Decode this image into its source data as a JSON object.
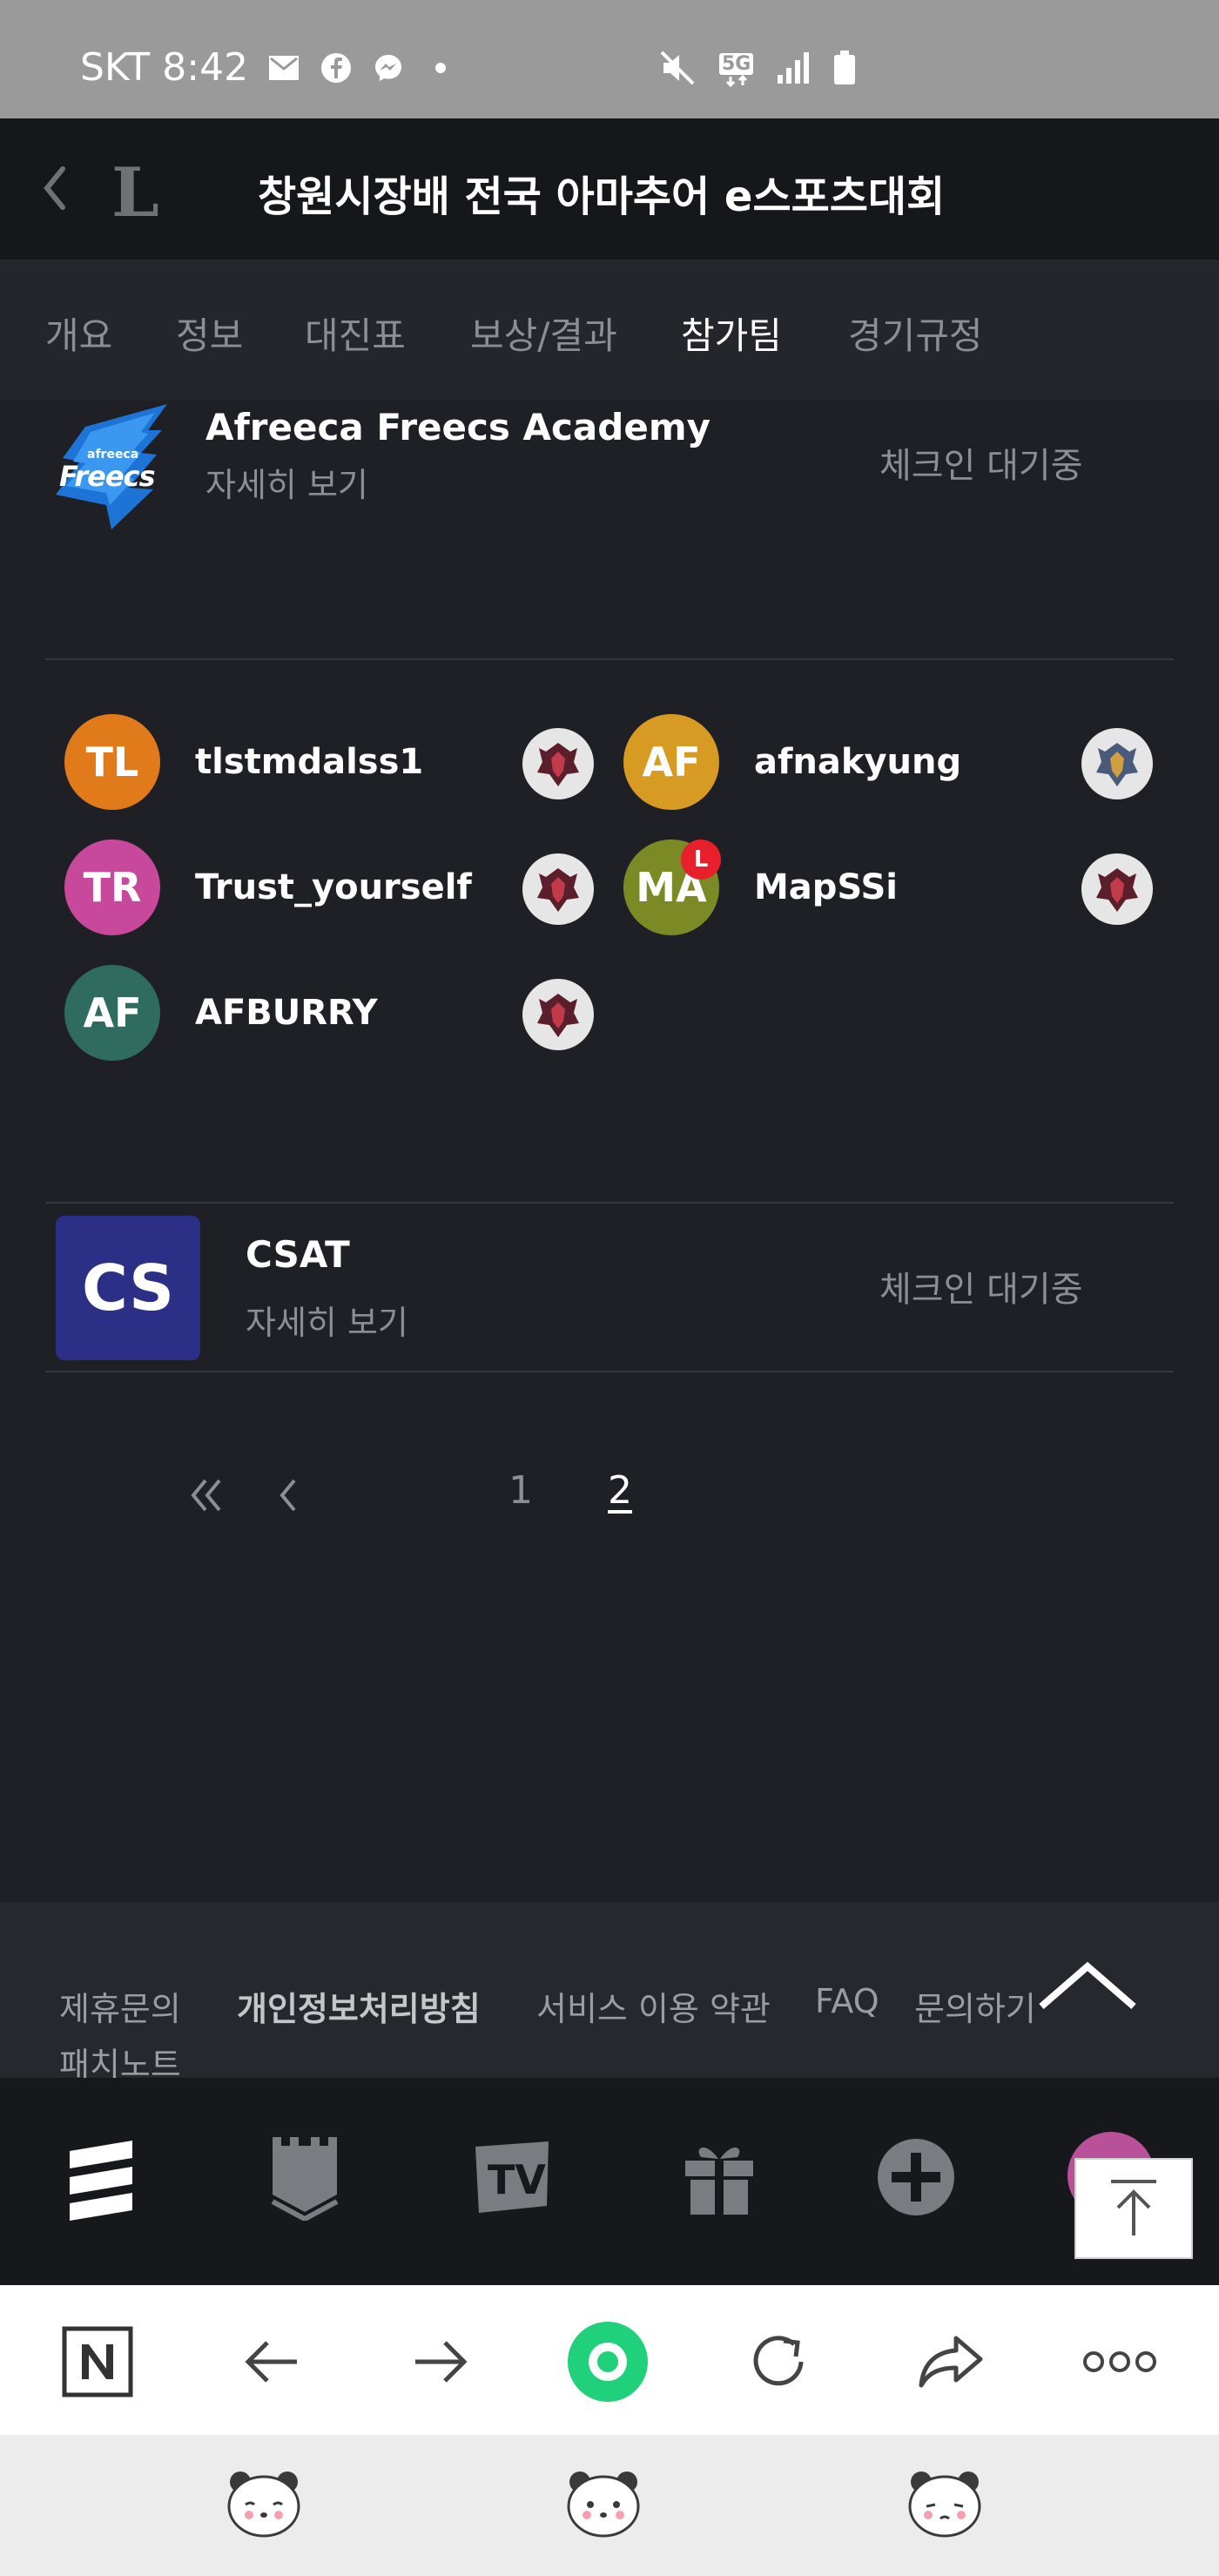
{
  "status_bar": {
    "carrier": "SKT",
    "time": "8:42",
    "network_label": "5G"
  },
  "header": {
    "logo_letter": "L",
    "title": "창원시장배 전국 아마추어 e스포츠대회"
  },
  "tabs": [
    {
      "label": "개요",
      "active": false
    },
    {
      "label": "정보",
      "active": false
    },
    {
      "label": "대진표",
      "active": false
    },
    {
      "label": "보상/결과",
      "active": false
    },
    {
      "label": "참가팀",
      "active": true
    },
    {
      "label": "경기규정",
      "active": false
    }
  ],
  "teams": [
    {
      "name": "Afreeca Freecs Academy",
      "logo_text_top": "afreeca",
      "logo_text_main": "Freecs",
      "detail_link": "자세히 보기",
      "status": "체크인 대기중",
      "members": [
        {
          "initials": "TL",
          "name": "tlstmdalss1",
          "color": "#e07a1a",
          "leader": false
        },
        {
          "initials": "AF",
          "name": "afnakyung",
          "color": "#d79a22",
          "leader": false
        },
        {
          "initials": "TR",
          "name": "Trust_yourself",
          "color": "#c8489b",
          "leader": false
        },
        {
          "initials": "MA",
          "name": "MapSSi",
          "color": "#7c8a26",
          "leader": true,
          "leader_badge": "L"
        },
        {
          "initials": "AF",
          "name": "AFBURRY",
          "color": "#2f6c5f",
          "leader": false
        }
      ]
    },
    {
      "name": "CSAT",
      "logo_text": "CS",
      "detail_link": "자세히 보기",
      "status": "체크인 대기중"
    }
  ],
  "pagination": {
    "pages": [
      "1",
      "2"
    ],
    "current": "2"
  },
  "footer": {
    "links": [
      "제휴문의",
      "개인정보처리방침",
      "서비스 이용 약관",
      "FAQ",
      "문의하기",
      "패치노트"
    ]
  },
  "app_nav": {
    "items": [
      "menu-icon",
      "clan-badge-icon",
      "tv-icon",
      "gift-icon",
      "add-icon",
      "profile-avatar"
    ]
  },
  "browser_bar": {
    "items": [
      "naver-n-icon",
      "back-arrow-icon",
      "forward-arrow-icon",
      "home-circle-icon",
      "reload-icon",
      "share-icon",
      "more-icon"
    ]
  },
  "colors": {
    "accent_green": "#21d07a",
    "background": "#1f2026"
  }
}
